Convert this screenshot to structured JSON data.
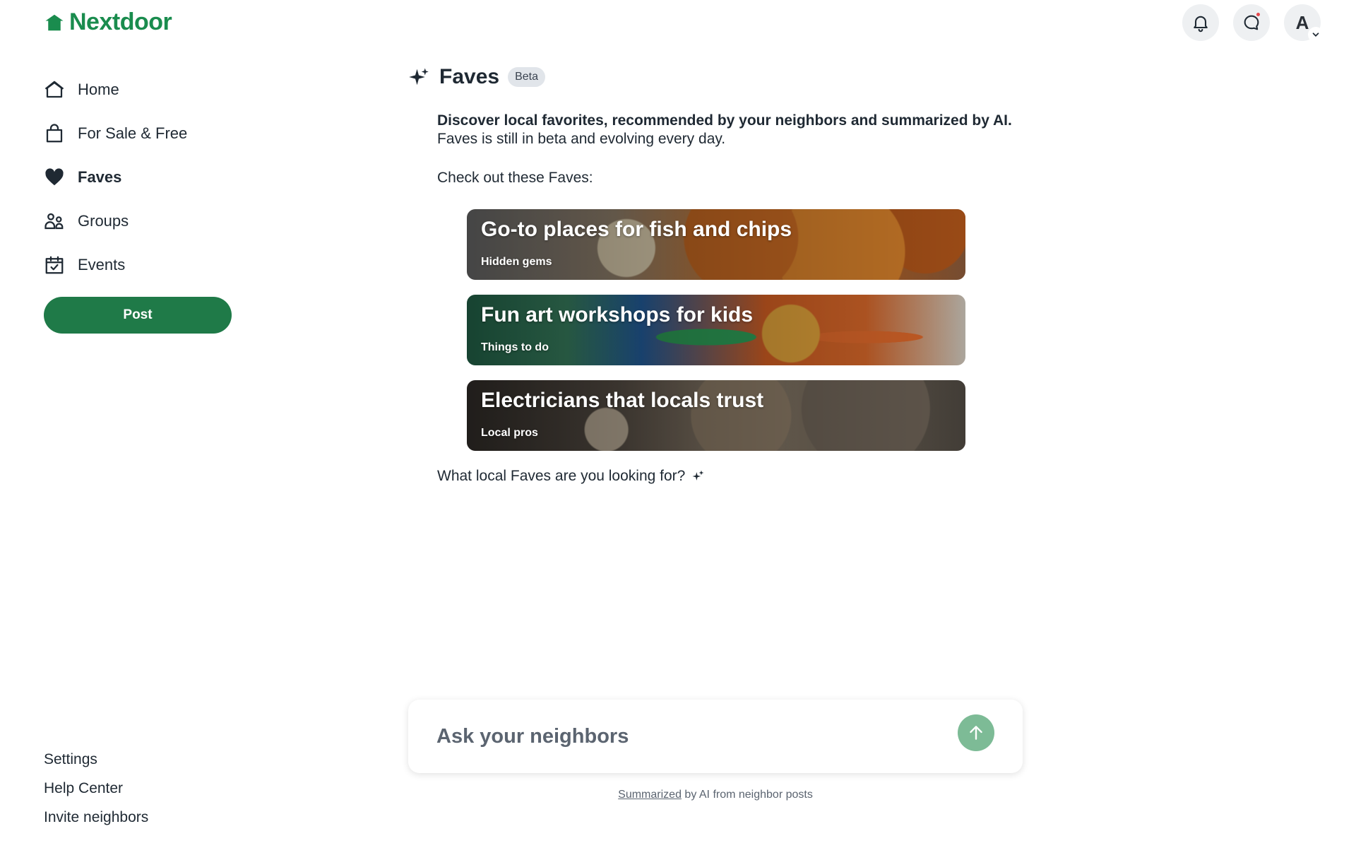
{
  "brand": {
    "name": "Nextdoor",
    "color": "#1a8c4e"
  },
  "header": {
    "notifications_icon": "bell-icon",
    "messages_icon": "chat-bubble-icon",
    "avatar_initial": "A"
  },
  "sidebar": {
    "items": [
      {
        "label": "Home",
        "icon": "home-icon",
        "active": false
      },
      {
        "label": "For Sale & Free",
        "icon": "shopping-bag-icon",
        "active": false
      },
      {
        "label": "Faves",
        "icon": "heart-icon",
        "active": true
      },
      {
        "label": "Groups",
        "icon": "people-icon",
        "active": false
      },
      {
        "label": "Events",
        "icon": "calendar-check-icon",
        "active": false
      }
    ],
    "post_label": "Post",
    "footer_links": [
      "Settings",
      "Help Center",
      "Invite neighbors"
    ]
  },
  "main": {
    "title": "Faves",
    "badge": "Beta",
    "intro_bold": "Discover local favorites, recommended by your neighbors and summarized by AI.",
    "intro_sub": "Faves is still in beta and evolving every day.",
    "check_out": "Check out these Faves:",
    "cards": [
      {
        "title": "Go-to places for fish and chips",
        "subtitle": "Hidden gems"
      },
      {
        "title": "Fun art workshops for kids",
        "subtitle": "Things to do"
      },
      {
        "title": "Electricians that locals trust",
        "subtitle": "Local pros"
      }
    ],
    "looking_prompt": "What local Faves are you looking for?",
    "ask_placeholder": "Ask your neighbors",
    "summary_link": "Summarized",
    "summary_rest": " by AI from neighbor posts"
  },
  "colors": {
    "post_button": "#1f7a48",
    "send_button": "#7dbb96",
    "notification_dot": "#e5484d"
  }
}
